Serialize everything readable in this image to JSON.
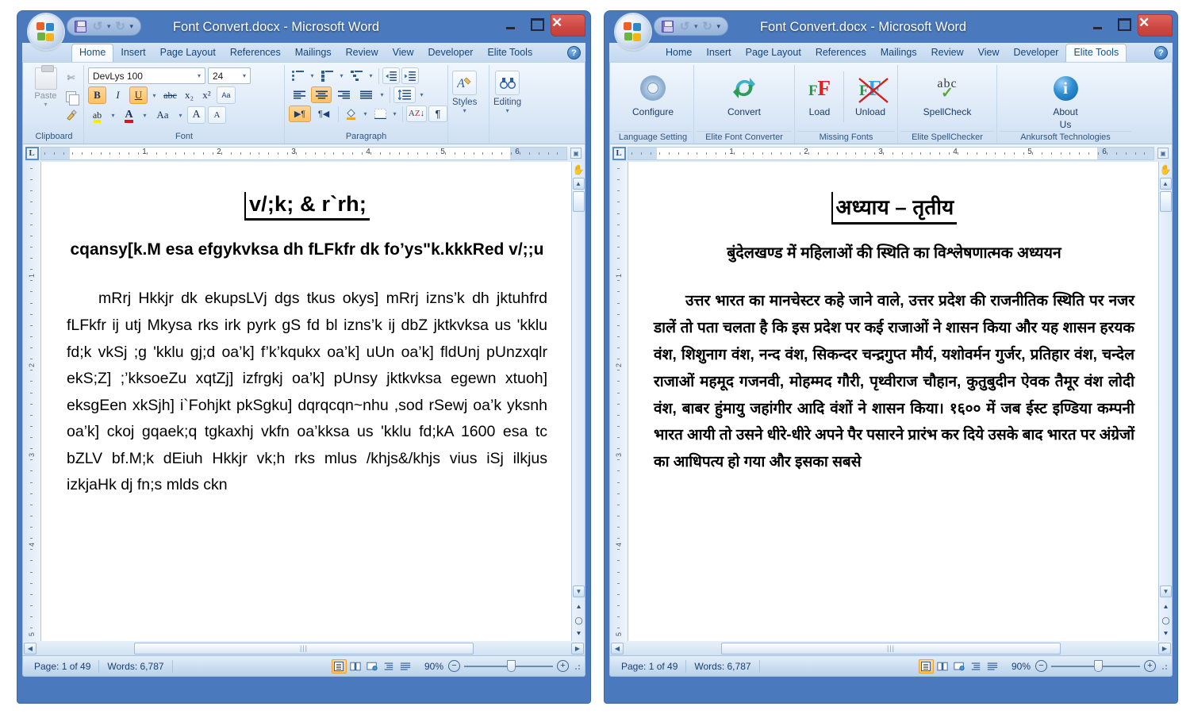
{
  "window": {
    "title": "Font Convert.docx - Microsoft Word",
    "minimize_label": "Minimize",
    "maximize_label": "Maximize",
    "close_label": "✕",
    "office_button_label": "Office Button",
    "help_label": "?",
    "qat": {
      "save_label": "Save",
      "undo_label": "Undo",
      "undo_caret": "▾",
      "redo_label": "Redo",
      "customize_caret": "▾"
    }
  },
  "tabs": [
    {
      "label": "Home"
    },
    {
      "label": "Insert"
    },
    {
      "label": "Page Layout"
    },
    {
      "label": "References"
    },
    {
      "label": "Mailings"
    },
    {
      "label": "Review"
    },
    {
      "label": "View"
    },
    {
      "label": "Developer"
    },
    {
      "label": "Elite Tools"
    }
  ],
  "left_window": {
    "active_tab": "Home",
    "ribbon": {
      "clipboard": {
        "group_label": "Clipboard",
        "paste_label": "Paste",
        "paste_caret": "▾",
        "cut_label": "Cut",
        "copy_label": "Copy",
        "format_painter_label": "Format Painter"
      },
      "font": {
        "group_label": "Font",
        "font_name": "DevLys 100",
        "font_size": "24",
        "bold_label": "B",
        "italic_label": "I",
        "underline_label": "U",
        "strikethrough_label": "abc",
        "subscript_label": "x₂",
        "superscript_label": "x²",
        "change_case_label": "Aa",
        "clear_formatting_label": "Aa",
        "highlight_label": "ab",
        "font_color_label": "A",
        "grow_font_label": "A",
        "shrink_font_label": "A",
        "caret": "▾"
      },
      "paragraph": {
        "group_label": "Paragraph",
        "bullets_label": "Bullets",
        "numbering_label": "Numbering",
        "multilevel_label": "Multilevel List",
        "decrease_indent_label": "Decrease Indent",
        "increase_indent_label": "Increase Indent",
        "align_left_label": "Align Left",
        "align_center_label": "Center",
        "align_right_label": "Align Right",
        "justify_label": "Justify",
        "line_spacing_label": "Line Spacing",
        "ltr_label": "▶¶",
        "rtl_label": "¶◀",
        "shading_label": "Shading",
        "borders_label": "Borders",
        "sort_label": "AZ",
        "show_marks_label": "¶",
        "caret": "▾"
      },
      "styles": {
        "group_label": "Styles",
        "label": "Styles",
        "caret": "▾"
      },
      "editing": {
        "group_label": "Editing",
        "label": "Editing",
        "caret": "▾"
      }
    },
    "document": {
      "title": "v/;k; & r`rh;",
      "subtitle": "cqansy[k.M esa efgykvksa dh fLFkfr dk fo’ys\"k.kkkRed v/;;u",
      "body": "mRrj Hkkjr dk ekupsLVj dgs tkus okys] mRrj izns’k dh jktuhfrd fLFkfr ij utj Mkysa rks irk pyrk gS fd bl izns’k ij dbZ jktkvksa us 'kklu fd;k vkSj ;g 'kklu gj;d oa’k] f’k’kqukx oa’k] uUn oa’k] fldUnj pUnzxqlr ekS;Z] ;’kksoeZu xqtZj] izfrgkj oa’k] pUnsy jktkvksa egewn xtuoh] eksgEen xkSjh] i`Fohjkt pkSgku] dqrqcqn~nhu ,sod rSewj oa’k yksnh oa’k] ckoj gqaek;q tgkaxhj vkfn oa’kksa us 'kklu fd;kA 1600 esa tc bZLV bf.M;k dEiuh Hkkjr vk;h rks mlus /khjs&/khjs vius iSj ilkjus izkjaHk dj fn;s mlds ckn"
    }
  },
  "right_window": {
    "active_tab": "Elite Tools",
    "ribbon": {
      "language_setting": {
        "group_label": "Language Setting",
        "buttons": [
          {
            "label": "Configure",
            "icon": "gear-icon"
          }
        ]
      },
      "elite_font_converter": {
        "group_label": "Elite Font Converter",
        "buttons": [
          {
            "label": "Convert",
            "icon": "convert-arrows-icon"
          }
        ]
      },
      "missing_fonts": {
        "group_label": "Missing Fonts",
        "buttons": [
          {
            "label": "Load",
            "icon": "load-font-icon"
          },
          {
            "label": "Unload",
            "icon": "unload-font-icon"
          }
        ]
      },
      "elite_spellchecker": {
        "group_label": "Elite SpellChecker",
        "buttons": [
          {
            "label": "SpellCheck",
            "icon": "abc-check-icon"
          }
        ]
      },
      "ankursoft": {
        "group_label": "Ankursoft Technologies",
        "buttons": [
          {
            "label": "About",
            "label2": "Us",
            "icon": "info-icon"
          }
        ]
      }
    },
    "document": {
      "title": "अध्याय – तृतीय",
      "subtitle": "बुंदेलखण्ड में महिलाओं की स्थिति का विश्लेषणात्मक अध्ययन",
      "body": "उत्तर भारत का मानचेस्टर कहे जाने वाले, उत्तर प्रदेश की राजनीतिक स्थिति पर नजर डालें तो पता चलता है कि इस प्रदेश पर कई राजाओं ने शासन किया और यह शासन हरयक वंश, शिशुनाग वंश, नन्द वंश, सिकन्दर चन्द्रगुप्त मौर्य, यशोवर्मन गुर्जर, प्रतिहार वंश, चन्देल राजाओं महमूद गजनवी, मोहम्मद गौरी, पृथ्वीराज चौहान, कुतुबुदीन ऐवक तैमूर वंश लोदी वंश, बाबर हुंमायु जहांगीर आदि वंशों ने शासन किया। १६०० में जब ईस्ट इण्डिया कम्पनी भारत आयी तो उसने धीरे-धीरे अपने पैर पसारने प्रारंभ कर दिये उसके बाद भारत पर अंग्रेजों का आधिपत्य हो गया और इसका सबसे"
    }
  },
  "ruler": {
    "tabstop_label": "L",
    "marks": [
      "1",
      "2",
      "3",
      "4",
      "5",
      "6"
    ],
    "vertical_marks": [
      "1",
      "2",
      "3",
      "4",
      "5"
    ]
  },
  "statusbar": {
    "page_label": "Page: 1 of 49",
    "words_label": "Words: 6,787",
    "zoom_label": "90%",
    "zoom_out_label": "−",
    "zoom_in_label": "+",
    "views": [
      {
        "name": "print-layout-view",
        "active": true
      },
      {
        "name": "full-screen-reading-view",
        "active": false
      },
      {
        "name": "web-layout-view",
        "active": false
      },
      {
        "name": "outline-view",
        "active": false
      },
      {
        "name": "draft-view",
        "active": false
      }
    ]
  },
  "scrollbars": {
    "up_label": "▲",
    "down_label": "▼",
    "left_label": "◀",
    "right_label": "▶",
    "prev_page_label": "⯅",
    "select_object_label": "◯",
    "next_page_label": "⯆",
    "thumb_grip": "|||"
  },
  "colors": {
    "window_frame": "#4a79bd",
    "ribbon_bg": "#e2edf9",
    "tab_text": "#12447e",
    "close_button": "#cd4843",
    "highlight_orange": "#ffc163"
  }
}
